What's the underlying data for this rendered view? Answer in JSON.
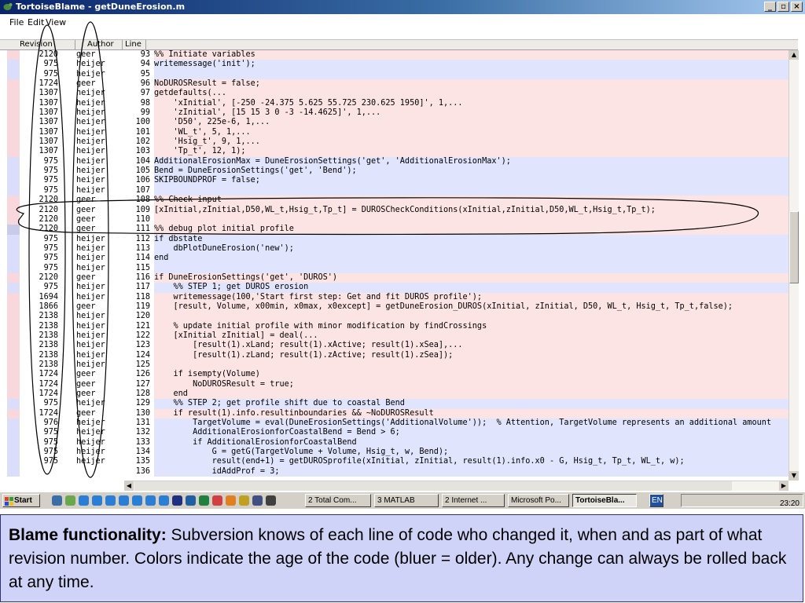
{
  "window": {
    "title": "TortoiseBlame - getDuneErosion.m"
  },
  "menu": [
    "File",
    "Edit",
    "View"
  ],
  "columns": {
    "revision": "Revision",
    "author": "Author",
    "line": "Line"
  },
  "colors": {
    "old_light": "#e0e4fc",
    "old_age": "#dadefb",
    "newer_light": "#fde4e4",
    "newer_age": "#f8d8dc",
    "selected_age": "#c8cce8",
    "annotation": "#000000",
    "caption_bg": "#cfd3f7"
  },
  "rows": [
    {
      "rev": "2120",
      "author": "geer",
      "line": "93",
      "code": "%% Initiate variables",
      "age": "new"
    },
    {
      "rev": "975",
      "author": "heijer",
      "line": "94",
      "code": "writemessage('init');",
      "age": "old"
    },
    {
      "rev": "975",
      "author": "heijer",
      "line": "95",
      "code": "",
      "age": "old"
    },
    {
      "rev": "1724",
      "author": "geer",
      "line": "96",
      "code": "NoDUROSResult = false;",
      "age": "new"
    },
    {
      "rev": "1307",
      "author": "heijer",
      "line": "97",
      "code": "getdefaults(...",
      "age": "new"
    },
    {
      "rev": "1307",
      "author": "heijer",
      "line": "98",
      "code": "    'xInitial', [-250 -24.375 5.625 55.725 230.625 1950]', 1,...",
      "age": "new"
    },
    {
      "rev": "1307",
      "author": "heijer",
      "line": "99",
      "code": "    'zInitial', [15 15 3 0 -3 -14.4625]', 1,...",
      "age": "new"
    },
    {
      "rev": "1307",
      "author": "heijer",
      "line": "100",
      "code": "    'D50', 225e-6, 1,...",
      "age": "new"
    },
    {
      "rev": "1307",
      "author": "heijer",
      "line": "101",
      "code": "    'WL_t', 5, 1,...",
      "age": "new"
    },
    {
      "rev": "1307",
      "author": "heijer",
      "line": "102",
      "code": "    'Hsig_t', 9, 1,...",
      "age": "new"
    },
    {
      "rev": "1307",
      "author": "heijer",
      "line": "103",
      "code": "    'Tp_t', 12, 1);",
      "age": "new"
    },
    {
      "rev": "975",
      "author": "heijer",
      "line": "104",
      "code": "AdditionalErosionMax = DuneErosionSettings('get', 'AdditionalErosionMax');",
      "age": "old"
    },
    {
      "rev": "975",
      "author": "heijer",
      "line": "105",
      "code": "Bend = DuneErosionSettings('get', 'Bend');",
      "age": "old"
    },
    {
      "rev": "975",
      "author": "heijer",
      "line": "106",
      "code": "SKIPBOUNDPROF = false;",
      "age": "old"
    },
    {
      "rev": "975",
      "author": "heijer",
      "line": "107",
      "code": "",
      "age": "old"
    },
    {
      "rev": "2120",
      "author": "geer",
      "line": "108",
      "code": "%% Check input",
      "age": "new"
    },
    {
      "rev": "2120",
      "author": "geer",
      "line": "109",
      "code": "[xInitial,zInitial,D50,WL_t,Hsig_t,Tp_t] = DUROSCheckConditions(xInitial,zInitial,D50,WL_t,Hsig_t,Tp_t);",
      "age": "new"
    },
    {
      "rev": "2120",
      "author": "geer",
      "line": "110",
      "code": "",
      "age": "new"
    },
    {
      "rev": "2120",
      "author": "geer",
      "line": "111",
      "code": "%% debug plot initial profile",
      "age": "sel"
    },
    {
      "rev": "975",
      "author": "heijer",
      "line": "112",
      "code": "if dbstate",
      "age": "old"
    },
    {
      "rev": "975",
      "author": "heijer",
      "line": "113",
      "code": "    dbPlotDuneErosion('new');",
      "age": "old"
    },
    {
      "rev": "975",
      "author": "heijer",
      "line": "114",
      "code": "end",
      "age": "old"
    },
    {
      "rev": "975",
      "author": "heijer",
      "line": "115",
      "code": "",
      "age": "old"
    },
    {
      "rev": "2120",
      "author": "geer",
      "line": "116",
      "code": "if DuneErosionSettings('get', 'DUROS')",
      "age": "new"
    },
    {
      "rev": "975",
      "author": "heijer",
      "line": "117",
      "code": "    %% STEP 1; get DUROS erosion",
      "age": "old"
    },
    {
      "rev": "1694",
      "author": "heijer",
      "line": "118",
      "code": "    writemessage(100,'Start first step: Get and fit DUROS profile');",
      "age": "new"
    },
    {
      "rev": "1866",
      "author": "geer",
      "line": "119",
      "code": "    [result, Volume, x00min, x0max, x0except] = getDuneErosion_DUROS(xInitial, zInitial, D50, WL_t, Hsig_t, Tp_t,false);",
      "age": "new"
    },
    {
      "rev": "2138",
      "author": "heijer",
      "line": "120",
      "code": "",
      "age": "new"
    },
    {
      "rev": "2138",
      "author": "heijer",
      "line": "121",
      "code": "    % update initial profile with minor modification by findCrossings",
      "age": "new"
    },
    {
      "rev": "2138",
      "author": "heijer",
      "line": "122",
      "code": "    [xInitial zInitial] = deal(...",
      "age": "new"
    },
    {
      "rev": "2138",
      "author": "heijer",
      "line": "123",
      "code": "        [result(1).xLand; result(1).xActive; result(1).xSea],...",
      "age": "new"
    },
    {
      "rev": "2138",
      "author": "heijer",
      "line": "124",
      "code": "        [result(1).zLand; result(1).zActive; result(1).zSea]);",
      "age": "new"
    },
    {
      "rev": "2138",
      "author": "heijer",
      "line": "125",
      "code": "",
      "age": "new"
    },
    {
      "rev": "1724",
      "author": "geer",
      "line": "126",
      "code": "    if isempty(Volume)",
      "age": "new"
    },
    {
      "rev": "1724",
      "author": "geer",
      "line": "127",
      "code": "        NoDUROSResult = true;",
      "age": "new"
    },
    {
      "rev": "1724",
      "author": "geer",
      "line": "128",
      "code": "    end",
      "age": "new"
    },
    {
      "rev": "975",
      "author": "heijer",
      "line": "129",
      "code": "    %% STEP 2; get profile shift due to coastal Bend",
      "age": "old"
    },
    {
      "rev": "1724",
      "author": "geer",
      "line": "130",
      "code": "    if result(1).info.resultinboundaries && ~NoDUROSResult",
      "age": "new"
    },
    {
      "rev": "976",
      "author": "heijer",
      "line": "131",
      "code": "        TargetVolume = eval(DuneErosionSettings('AdditionalVolume'));  % Attention, TargetVolume represents an additional amount",
      "age": "old"
    },
    {
      "rev": "975",
      "author": "heijer",
      "line": "132",
      "code": "        AdditionalErosionforCoastalBend = Bend > 6;",
      "age": "old"
    },
    {
      "rev": "975",
      "author": "heijer",
      "line": "133",
      "code": "        if AdditionalErosionforCoastalBend",
      "age": "old"
    },
    {
      "rev": "975",
      "author": "heijer",
      "line": "134",
      "code": "            G = getG(TargetVolume + Volume, Hsig_t, w, Bend);",
      "age": "old"
    },
    {
      "rev": "975",
      "author": "heijer",
      "line": "135",
      "code": "            result(end+1) = getDUROSprofile(xInitial, zInitial, result(1).info.x0 - G, Hsig_t, Tp_t, WL_t, w);",
      "age": "old"
    },
    {
      "rev": "",
      "author": "",
      "line": "136",
      "code": "            idAddProf = 3;",
      "age": "old"
    }
  ],
  "taskbar": {
    "start": "Start",
    "items": [
      "2 Total Com...",
      "3 MATLAB",
      "2 Internet ...",
      "Microsoft Po...",
      "TortoiseBla..."
    ],
    "lang": "EN",
    "clock": "23:20"
  },
  "caption": {
    "bold": "Blame functionality:",
    "text": " Subversion knows of each line of code who changed it, when and as part of what revision number. Colors indicate the age of the code (bluer  = older). Any change can always be rolled back at any time."
  }
}
